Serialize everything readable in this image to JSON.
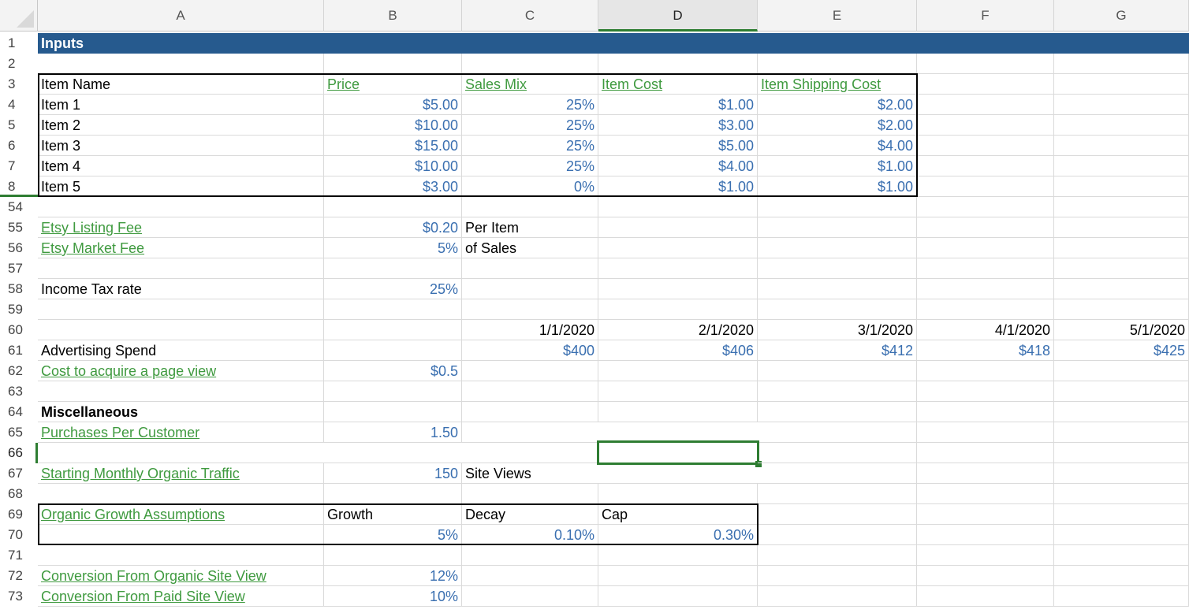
{
  "columns": [
    "A",
    "B",
    "C",
    "D",
    "E",
    "F",
    "G"
  ],
  "rows": [
    "1",
    "2",
    "3",
    "4",
    "5",
    "6",
    "7",
    "8",
    "54",
    "55",
    "56",
    "57",
    "58",
    "59",
    "60",
    "61",
    "62",
    "63",
    "64",
    "65",
    "66",
    "67",
    "68",
    "69",
    "70",
    "71",
    "72",
    "73"
  ],
  "banner": "Inputs",
  "items_table": {
    "headers": {
      "name": "Item Name",
      "price": "Price",
      "mix": "Sales Mix",
      "cost": "Item Cost",
      "ship": "Item Shipping Cost"
    },
    "rows": [
      {
        "name": "Item 1",
        "price": "$5.00",
        "mix": "25%",
        "cost": "$1.00",
        "ship": "$2.00"
      },
      {
        "name": "Item 2",
        "price": "$10.00",
        "mix": "25%",
        "cost": "$3.00",
        "ship": "$2.00"
      },
      {
        "name": "Item 3",
        "price": "$15.00",
        "mix": "25%",
        "cost": "$5.00",
        "ship": "$4.00"
      },
      {
        "name": "Item 4",
        "price": "$10.00",
        "mix": "25%",
        "cost": "$4.00",
        "ship": "$1.00"
      },
      {
        "name": "Item 5",
        "price": "$3.00",
        "mix": "0%",
        "cost": "$1.00",
        "ship": "$1.00"
      }
    ]
  },
  "fees": {
    "listing_label": "Etsy Listing Fee",
    "listing_value": "$0.20",
    "listing_unit": "Per Item",
    "market_label": "Etsy Market Fee",
    "market_value": "5%",
    "market_unit": "of Sales"
  },
  "tax": {
    "label": "Income Tax rate",
    "value": "25%"
  },
  "dates": [
    "1/1/2020",
    "2/1/2020",
    "3/1/2020",
    "4/1/2020",
    "5/1/2020"
  ],
  "ad_spend": {
    "label": "Advertising Spend",
    "values": [
      "$400",
      "$406",
      "$412",
      "$418",
      "$425"
    ]
  },
  "page_view": {
    "label": "Cost to acquire a page view",
    "value": "$0.5"
  },
  "misc": {
    "label": "Miscellaneous"
  },
  "purchases": {
    "label": "Purchases Per Customer",
    "value": "1.50"
  },
  "traffic": {
    "label": "Starting Monthly Organic Traffic",
    "value": "150",
    "unit": "Site Views"
  },
  "growth": {
    "label": "Organic Growth Assumptions",
    "growth_label": "Growth",
    "decay_label": "Decay",
    "cap_label": "Cap",
    "growth_value": "5%",
    "decay_value": "0.10%",
    "cap_value": "0.30%"
  },
  "conversion": {
    "organic_label": "Conversion From Organic Site View",
    "organic_value": "12%",
    "paid_label": "Conversion From Paid Site View",
    "paid_value": "10%"
  }
}
